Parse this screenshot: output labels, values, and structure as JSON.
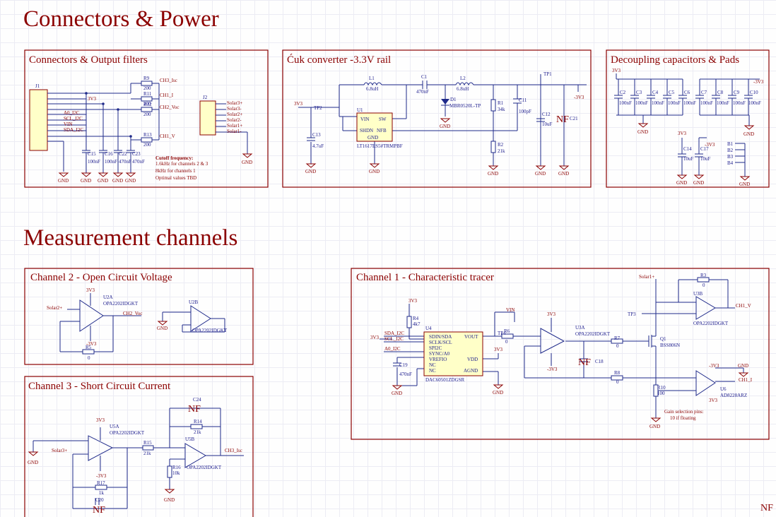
{
  "sections": {
    "power": "Connectors & Power",
    "measurement": "Measurement channels"
  },
  "blocks": {
    "connectors": "Connectors & Output filters",
    "cuk": "Ćuk converter -3.3V rail",
    "decoupling": "Decoupling capacitors & Pads",
    "ch2": "Channel 2 - Open Circuit Voltage",
    "ch1": "Channel 1 - Characteristic tracer",
    "ch3": "Channel 3 - Short Circuit Current"
  },
  "nets": {
    "v33": "3V3",
    "vm33": "-3V3",
    "gnd": "GND",
    "ch1_i": "CH1_I",
    "ch1_v": "CH1_V",
    "ch2_voc": "CH2_Voc",
    "ch3_isc": "CH3_Isc",
    "a0_i2c": "A0_I2C",
    "scl_i2c": "SCL_I2C",
    "sda_i2c": "SDA_I2C",
    "vin": "VIN",
    "solar1p": "Solar1+",
    "solar2p": "Solar2+",
    "solar3p": "Solar3+",
    "solar1m": "Solar1-",
    "solar2m": "Solar2-",
    "solar3m": "Solar3-",
    "tp1": "TP1",
    "tp2": "TP2",
    "tp3": "TP3",
    "tp4": "TP4"
  },
  "connectors": {
    "j1": "J1",
    "j2": "J2",
    "r9": "R9",
    "r11": "R11",
    "r12": "R12",
    "r13": "R13",
    "r_val": "200",
    "c15": "C15",
    "c16": "C16",
    "c22": "C22",
    "c23": "C23",
    "v100n": "100nF",
    "v470n": "470nF",
    "cutoff_title": "Cutoff frequency:",
    "cutoff_l1": "1.6kHz for channels 2 & 3",
    "cutoff_l2": "8kHz for channels 1",
    "cutoff_l3": "Optimal values TBD"
  },
  "cuk": {
    "l1": "L1",
    "l1v": "6.8uH",
    "c1": "C1",
    "c1v": "470nF",
    "l2": "L2",
    "l2v": "6.8uH",
    "d1": "D1",
    "d1v": "MBR0520L-TP",
    "u1": "U1",
    "u1part": "LT1617ES5#TRMPBF",
    "pin_vin": "VIN",
    "pin_sw": "SW",
    "pin_shdn": "SHDN",
    "pin_nfb": "NFB",
    "pin_gnd": "GND",
    "r1": "R1",
    "r1v": "34k",
    "r2": "R2",
    "r2v": "21k",
    "c11": "C11",
    "c11v": "100pF",
    "c12": "C12",
    "c12v": "10uF",
    "c13": "C13",
    "c13v": "4.7uF",
    "c21": "C21",
    "nf": "NF"
  },
  "decoupling": {
    "caps": [
      "C2",
      "C3",
      "C4",
      "C5",
      "C6",
      "C7",
      "C8",
      "C9",
      "C10"
    ],
    "val": "100nF",
    "c14": "C14",
    "c17": "C17",
    "c10u": "10uF",
    "pads": [
      "B1",
      "B2",
      "B3",
      "B4"
    ]
  },
  "ch2": {
    "u2a": "U2A",
    "u2b": "U2B",
    "part": "OPA2202IDGKT",
    "r5": "R5",
    "r5v": "0"
  },
  "ch1": {
    "r4": "R4",
    "r4v": "4k7",
    "u4": "U4",
    "pins": [
      "SDIN/SDA",
      "SCLK/SCL",
      "SPI2C",
      "SYNC/A0",
      "VREFIO",
      "NC",
      "NC"
    ],
    "vout": "VOUT",
    "vdd": "VDD",
    "agnd": "AGND",
    "u4part": "DAC60501ZDGSR",
    "c19": "C19",
    "c19v": "470nF",
    "r6": "R6",
    "r6v": "0",
    "u3a": "U3A",
    "part": "OPA2202IDGKT",
    "r7": "R7",
    "r7v": "0",
    "r8": "R8",
    "r8v": "0",
    "q1": "Q1",
    "q1part": "BSS806N",
    "c18": "C18",
    "r3": "R3",
    "r3v": "0",
    "u3b": "U3B",
    "r10": "R10",
    "r10v": "100",
    "u6": "U6",
    "u6part": "AD8228ARZ",
    "gain_note1": "Gain selection pins:",
    "gain_note2": "10 if floating"
  },
  "ch3": {
    "u5a": "U5A",
    "u5b": "U5B",
    "part": "OPA2202IDGKT",
    "r15": "R15",
    "r15v": "21k",
    "r14": "R14",
    "r14v": "21k",
    "r16": "R16",
    "r16v": "10k",
    "r17": "R17",
    "r17v": "1k",
    "c24": "C24",
    "c20": "C20"
  },
  "corner_nf": "NF"
}
